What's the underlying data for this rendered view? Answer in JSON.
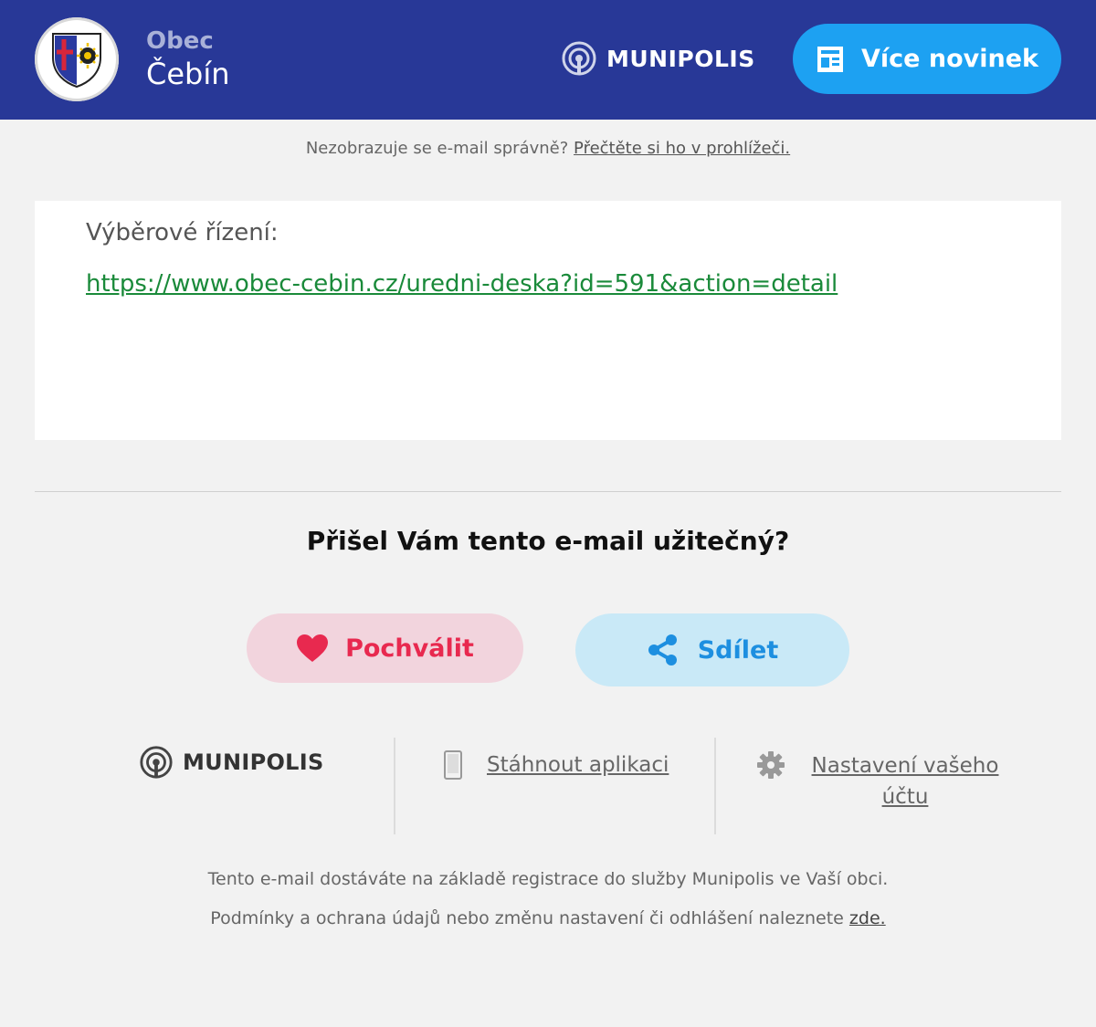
{
  "header": {
    "town_label": "Obec",
    "town_name": "Čebín",
    "brand": "MUNIPOLIS",
    "more_news_label": "Více novinek"
  },
  "notice": {
    "text": "Nezobrazuje se e-mail správně?",
    "link_label": "Přečtěte si ho v prohlížeči."
  },
  "article": {
    "title": "Výběrové řízení:",
    "link": "https://www.obec-cebin.cz/uredni-deska?id=591&action=detail"
  },
  "feedback": {
    "question": "Přišel Vám tento e-mail užitečný?",
    "praise_label": "Pochválit",
    "share_label": "Sdílet"
  },
  "footer": {
    "brand": "MUNIPOLIS",
    "app_label": "Stáhnout aplikaci",
    "settings_label": "Nastavení vašeho účtu",
    "registration_text": "Tento e-mail dostáváte na základě registrace do služby Munipolis ve Vaší obci.",
    "terms_text": "Podmínky a ochrana údajů nebo změnu nastavení či odhlášení naleznete",
    "terms_link": "zde."
  },
  "icons": {
    "header_logo": "coat-of-arms-icon",
    "brand_mark": "broadcast-icon",
    "more_news": "newspaper-icon",
    "praise": "heart-icon",
    "share": "share-icon",
    "app": "phone-icon",
    "settings": "gear-icon"
  },
  "colors": {
    "header_bg": "#283897",
    "accent_blue": "#1da1f2",
    "praise_red": "#e8294f",
    "link_green": "#1a8a3a"
  }
}
